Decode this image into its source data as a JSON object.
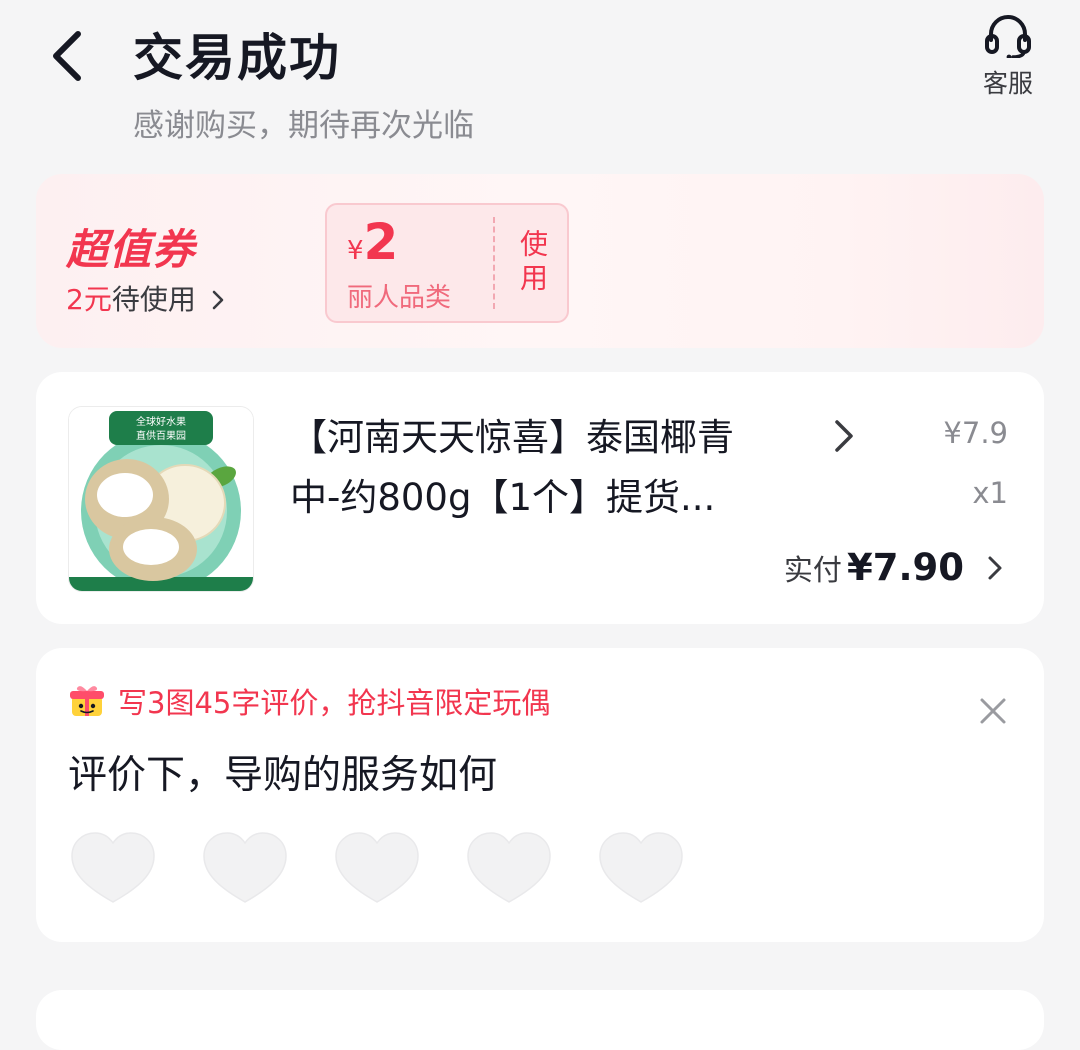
{
  "header": {
    "title": "交易成功",
    "subtitle": "感谢购买，期待再次光临",
    "service_label": "客服"
  },
  "coupon": {
    "brand": "超值券",
    "status_amount": "2元",
    "status_text": "待使用",
    "ticket": {
      "currency": "¥",
      "value": "2",
      "category": "丽人品类",
      "use_label": "使用"
    }
  },
  "product": {
    "title_line1": "【河南天天惊喜】泰国椰青",
    "title_line2": "中-约800g【1个】提货...",
    "unit_price": "¥7.9",
    "quantity": "x1",
    "paid_label": "实付",
    "paid_amount": "¥7.90",
    "thumb_badge_line1": "全球好水果",
    "thumb_badge_line2": "直供百果园"
  },
  "review": {
    "promo": "写3图45字评价，抢抖音限定玩偶",
    "question": "评价下，导购的服务如何",
    "rating_max": 5,
    "rating_value": 0
  },
  "colors": {
    "accent": "#f2364f",
    "background": "#f5f5f6",
    "card": "#ffffff",
    "text_primary": "#161823",
    "text_secondary": "#8a8b91",
    "heart_empty": "#f2f2f3"
  },
  "icons": [
    "back-arrow-icon",
    "headset-icon",
    "chevron-right-icon",
    "gift-box-icon",
    "close-icon",
    "heart-icon"
  ]
}
